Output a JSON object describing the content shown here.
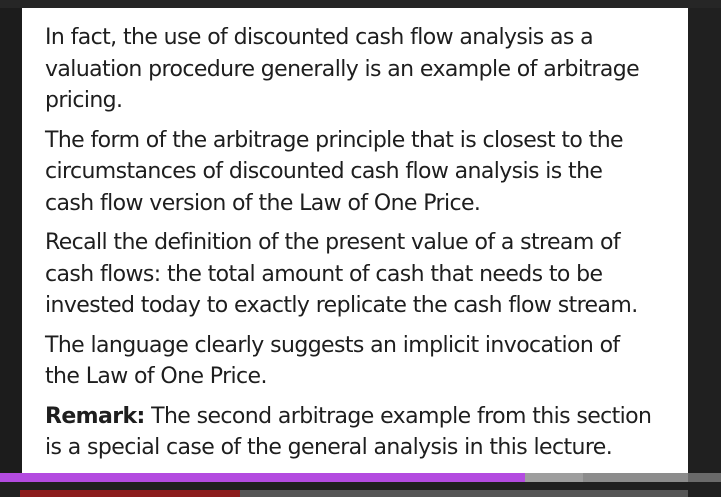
{
  "slide": {
    "paragraphs": [
      {
        "lines": [
          "In fact, the use of discounted cash flow analysis as a",
          "valuation procedure generally is an example of arbitrage",
          "pricing."
        ]
      },
      {
        "lines": [
          "The form of the arbitrage principle that is closest to the",
          "circumstances of discounted cash flow analysis is the",
          "cash flow version of the Law of One Price."
        ]
      },
      {
        "lines": [
          "Recall the definition of the present value of a stream of",
          "cash flows: the total amount of cash that needs to be",
          "invested today to exactly replicate the cash flow stream."
        ]
      },
      {
        "lines": [
          "The language clearly suggests an implicit invocation of",
          "the Law of One Price."
        ]
      }
    ],
    "remark": {
      "label": "Remark:",
      "lines": [
        " The second arbitrage example from this section",
        "is a special case of the general analysis in this lecture."
      ]
    }
  },
  "video": {
    "played_fraction": 0.728,
    "buffered_fraction": 0.809
  },
  "colors": {
    "progress_played": "#b34be0",
    "progress_buffered": "#9e9e9e",
    "footer_accent": "#8c1c1c"
  }
}
